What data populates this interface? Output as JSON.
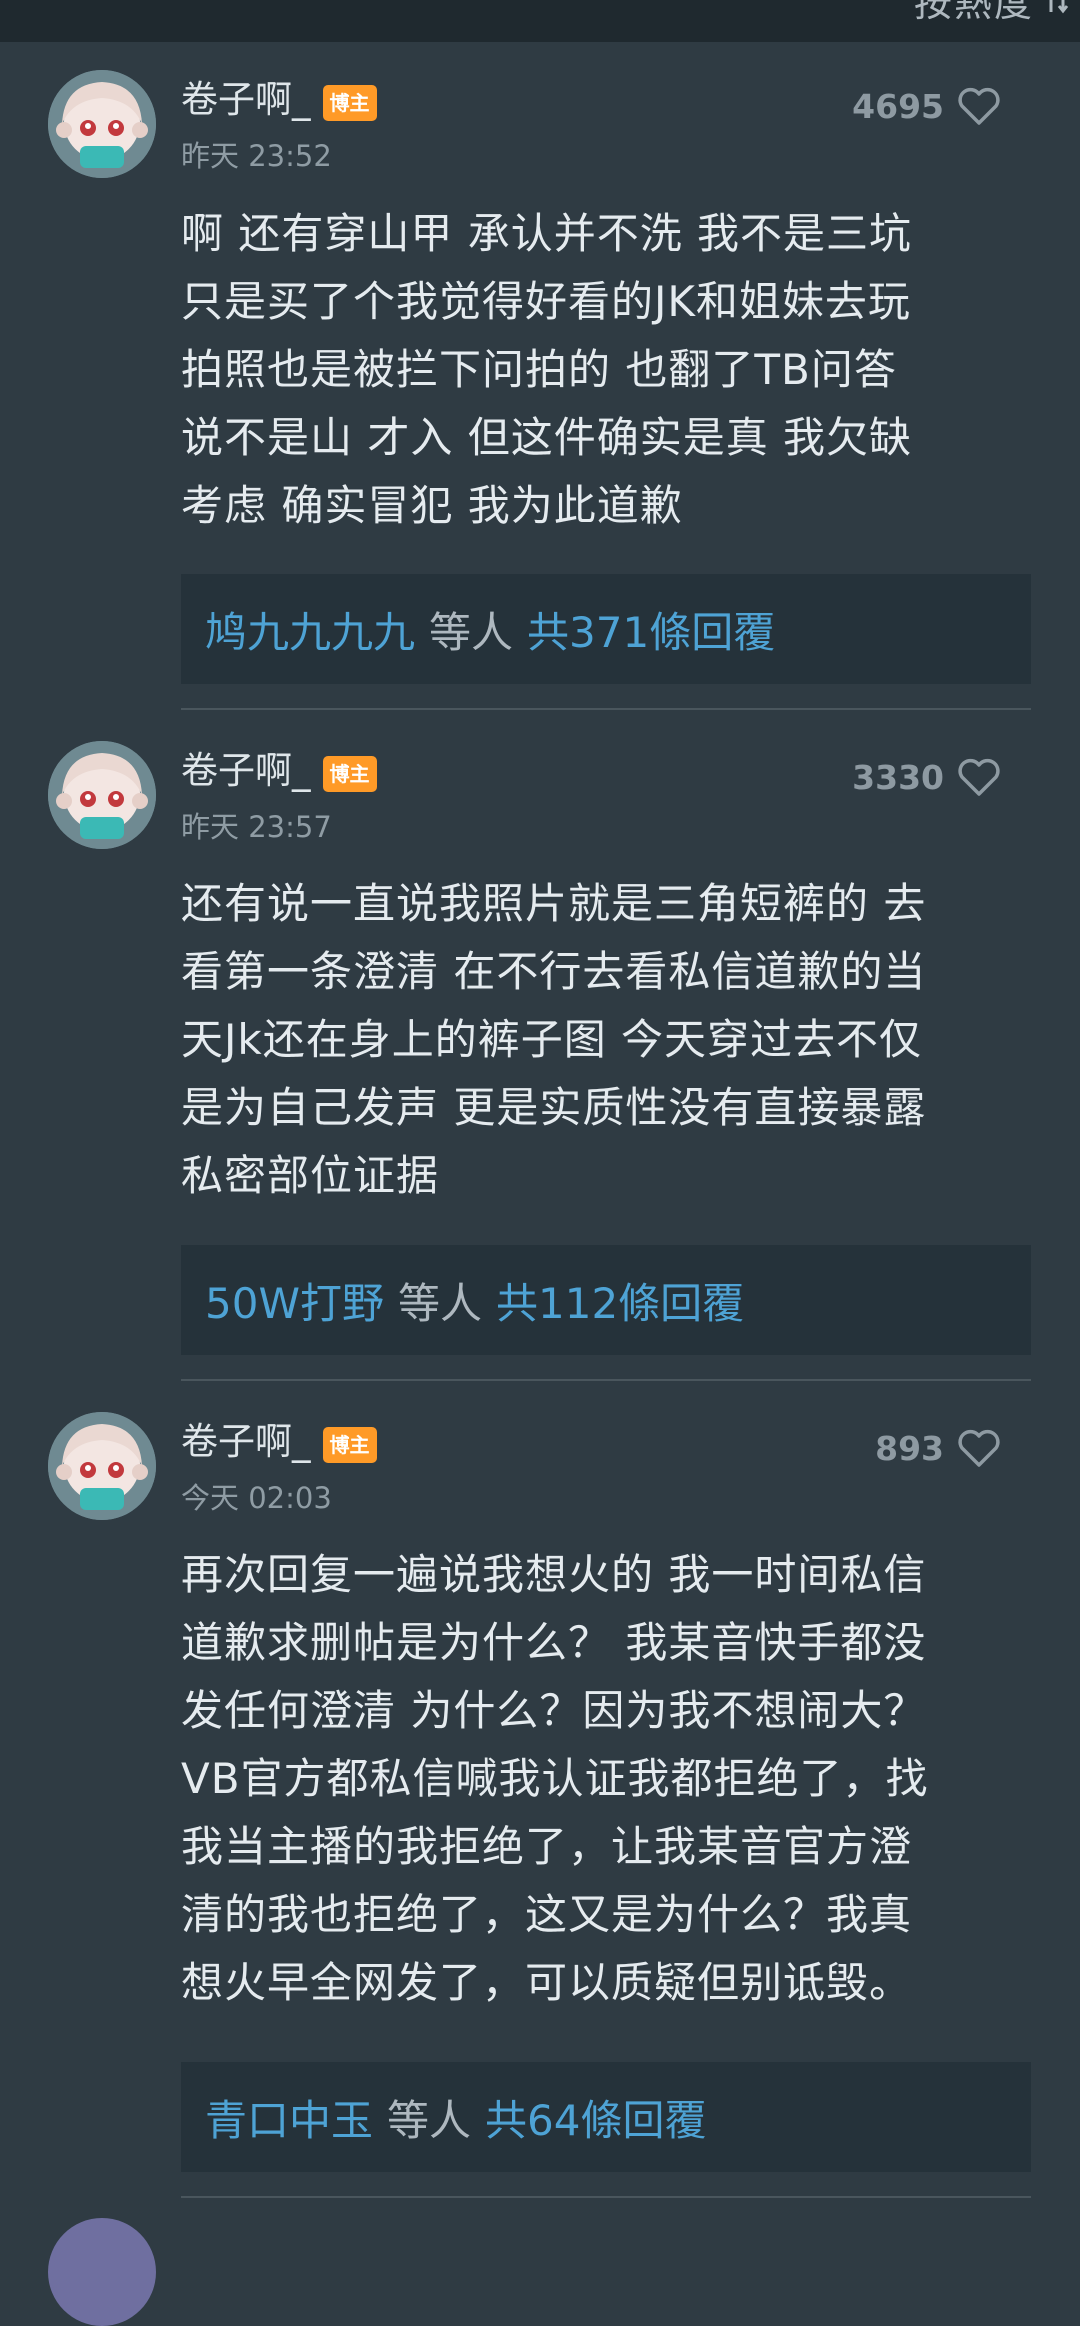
{
  "topbar": {
    "sort_label": "按熱度",
    "sort_icon": "sort-arrows-icon"
  },
  "comments": [
    {
      "username": "卷子啊_",
      "badge": "博主",
      "time": "昨天 23:52",
      "likes": "4695",
      "text": "啊 还有穿山甲 承认并不洗 我不是三坑\n只是买了个我觉得好看的JK和姐妹去玩\n拍照也是被拦下问拍的 也翻了TB问答\n说不是山 才入 但这件确实是真 我欠缺\n考虑 确实冒犯 我为此道歉",
      "reply_names": "鸠九九九九",
      "reply_etc": "等人",
      "reply_count": "共371條回覆"
    },
    {
      "username": "卷子啊_",
      "badge": "博主",
      "time": "昨天 23:57",
      "likes": "3330",
      "text": "还有说一直说我照片就是三角短裤的 去\n看第一条澄清 在不行去看私信道歉的当\n天Jk还在身上的裤子图 今天穿过去不仅\n是为自己发声 更是实质性没有直接暴露\n私密部位证据",
      "reply_names": "50W打野",
      "reply_etc": "等人",
      "reply_count": "共112條回覆"
    },
    {
      "username": "卷子啊_",
      "badge": "博主",
      "time": "今天 02:03",
      "likes": "893",
      "text": "再次回复一遍说我想火的 我一时间私信\n道歉求删帖是为什么？ 我某音快手都没\n发任何澄清 为什么？因为我不想闹大？\nVB官方都私信喊我认证我都拒绝了，找\n我当主播的我拒绝了，让我某音官方澄\n清的我也拒绝了，这又是为什么？我真\n想火早全网发了，可以质疑但别诋毁。",
      "reply_names": "青口中玉",
      "reply_etc": "等人",
      "reply_count": "共64條回覆"
    }
  ],
  "colors": {
    "background": "#2f3b43",
    "reply_box": "#25323a",
    "link": "#4ea3d5",
    "badge": "#ff9a27"
  }
}
